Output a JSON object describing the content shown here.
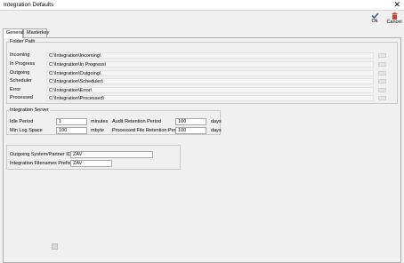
{
  "window": {
    "title": "Integration Defaults",
    "close_glyph": "✕"
  },
  "toolbar": {
    "ok_label": "Ok",
    "cancel_label": "Cancel",
    "ok_icon": "check-icon",
    "cancel_icon": "trash-icon",
    "ok_color": "#3c5a9a",
    "cancel_color": "#d03a2a"
  },
  "tabs": [
    {
      "label": "General",
      "active": true
    },
    {
      "label": "Masterkey",
      "active": false
    }
  ],
  "folder_path": {
    "legend": "Folder Path",
    "rows": [
      {
        "label": "Incoming",
        "value": "C:\\Integration\\Incoming\\"
      },
      {
        "label": "In Progress",
        "value": "C:\\Integration\\In Progress\\"
      },
      {
        "label": "Outgoing",
        "value": "C:\\Integration\\Outgoing\\"
      },
      {
        "label": "Scheduler",
        "value": "C:\\Integration\\Scheduler\\"
      },
      {
        "label": "Error",
        "value": "C:\\Integration\\Error\\"
      },
      {
        "label": "Processed",
        "value": "C:\\Integration\\Processed\\"
      }
    ]
  },
  "integration_server": {
    "legend": "Integration Server",
    "idle_period": {
      "label": "Idle Period",
      "value": "1",
      "unit": "minutes"
    },
    "min_log_space": {
      "label": "Min Log Space",
      "value": "100",
      "unit": "mbyte"
    },
    "audit_retention": {
      "label": "Audit Retention Period",
      "value": "100",
      "unit": "days"
    },
    "processed_retention": {
      "label": "Processed File Retention Period",
      "value": "100",
      "unit": "days"
    }
  },
  "partner": {
    "system_id": {
      "label": "Outgoing System/Partner ID",
      "value": "ZAV"
    },
    "filename_prefix": {
      "label": "Integration Filenames Prefix",
      "value": "ZAV"
    }
  }
}
